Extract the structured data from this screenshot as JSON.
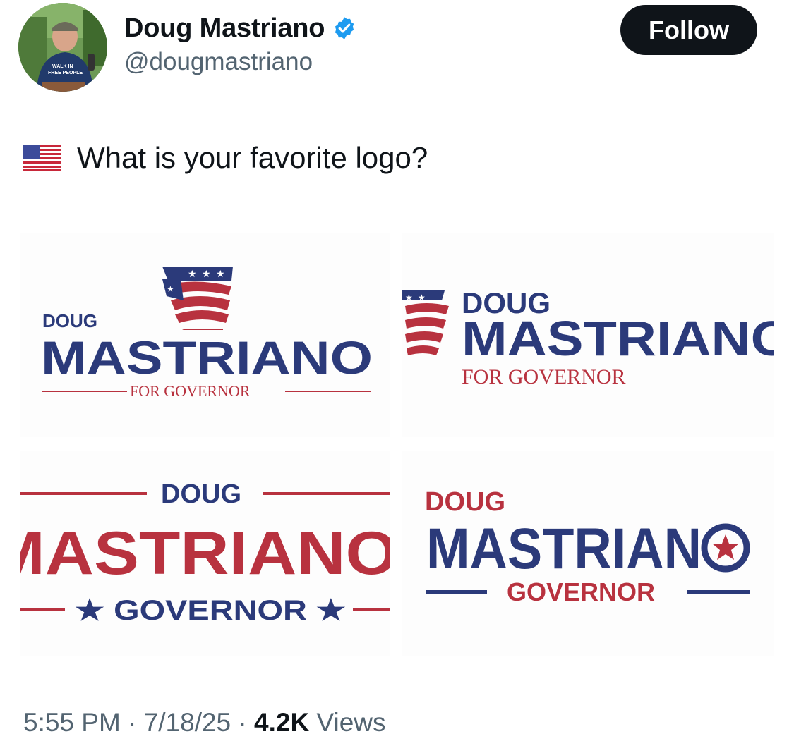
{
  "author": {
    "display_name": "Doug Mastriano",
    "handle": "@dougmastriano",
    "avatar_shirt_text": "WALK IN FREE PEOPLE"
  },
  "follow_label": "Follow",
  "tweet": {
    "flag_icon": "us-flag-emoji",
    "text": "What is your favorite logo?"
  },
  "logos": [
    {
      "first": "DOUG",
      "last": "MASTRIANO",
      "tag": "FOR GOVERNOR"
    },
    {
      "first": "DOUG",
      "last": "MASTRIANO",
      "tag": "FOR GOVERNOR"
    },
    {
      "first": "DOUG",
      "last": "MASTRIANO",
      "tag": "★ GOVERNOR ★"
    },
    {
      "first": "DOUG",
      "last": "MASTRIAN",
      "tag": "GOVERNOR"
    }
  ],
  "meta": {
    "time": "5:55 PM",
    "sep": " · ",
    "date": "7/18/25",
    "views_count": "4.2K",
    "views_label": " Views"
  },
  "colors": {
    "navy": "#2b3a7a",
    "red": "#b8323f",
    "verified": "#1d9bf0",
    "muted": "#536471"
  }
}
